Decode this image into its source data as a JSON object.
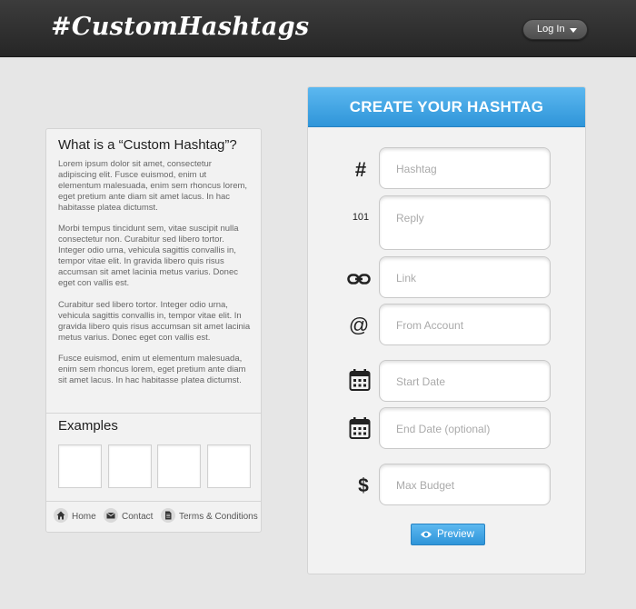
{
  "header": {
    "logo": "#CustomHashtags",
    "login_label": "Log In"
  },
  "left": {
    "title": "What is a “Custom Hashtag”?",
    "paragraphs": [
      "Lorem ipsum dolor sit amet, consectetur adipiscing elit. Fusce euismod, enim ut elementum malesuada, enim sem rhoncus lorem, eget pretium ante diam sit amet lacus. In hac habitasse platea dictumst.",
      "Morbi tempus tincidunt sem, vitae suscipit nulla consectetur non. Curabitur sed libero tortor. Integer odio urna, vehicula sagittis convallis in, tempor vitae elit. In gravida libero quis risus accumsan sit amet lacinia metus varius. Donec eget con vallis est.",
      "Curabitur sed libero tortor. Integer odio urna, vehicula sagittis convallis in,  tempor vitae elit. In gravida libero quis risus accumsan sit amet lacinia metus varius. Donec eget con vallis est.",
      "Fusce euismod, enim ut elementum malesuada, enim sem rhoncus lorem, eget pretium ante diam sit amet lacus. In hac habitasse platea dictumst."
    ],
    "examples_title": "Examples",
    "footer": {
      "home": "Home",
      "contact": "Contact",
      "terms": "Terms & Conditions"
    }
  },
  "form": {
    "header": "CREATE YOUR HASHTAG",
    "hash_symbol": "#",
    "reply_symbol": "101",
    "at_symbol": "@",
    "dollar_symbol": "$",
    "hashtag_placeholder": "Hashtag",
    "reply_placeholder": "Reply",
    "link_placeholder": "Link",
    "from_placeholder": "From Account",
    "start_placeholder": "Start Date",
    "end_placeholder": "End Date (optional)",
    "budget_placeholder": "Max Budget",
    "preview_label": "Preview"
  },
  "colors": {
    "accent": "#3aa3e3",
    "topbar": "#2e2e2e",
    "background": "#e6e6e6"
  }
}
